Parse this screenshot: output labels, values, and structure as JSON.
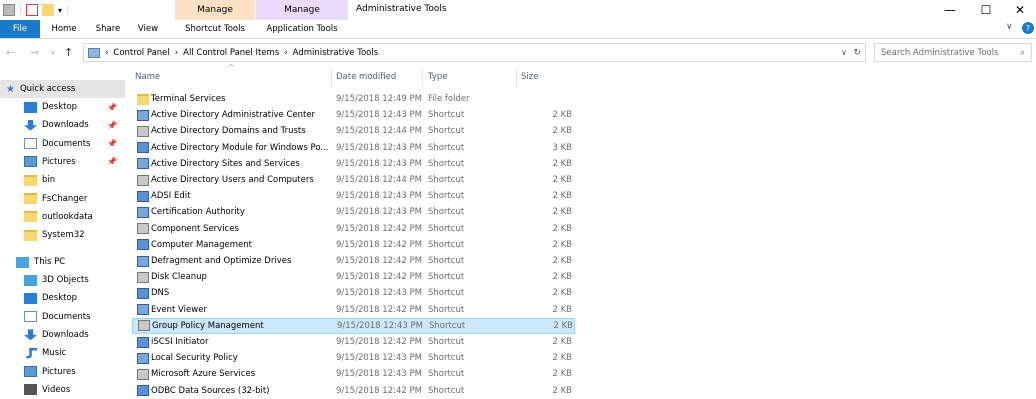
{
  "window": {
    "title": "Administrative Tools",
    "context_groups": [
      {
        "header": "Manage",
        "tab": "Shortcut Tools",
        "color": "#fde1c4"
      },
      {
        "header": "Manage",
        "tab": "Application Tools",
        "color": "#e9dbf9"
      }
    ],
    "controls": {
      "minimize": "—",
      "maximize": "☐",
      "close": "✕"
    }
  },
  "ribbon": {
    "tabs": [
      "File",
      "Home",
      "Share",
      "View"
    ],
    "file_color": "#1979ca"
  },
  "address": {
    "crumbs": [
      "Control Panel",
      "All Control Panel Items",
      "Administrative Tools"
    ],
    "separator": "›",
    "search_placeholder": "Search Administrative Tools"
  },
  "nav": {
    "quick_access": "Quick access",
    "quick_items": [
      {
        "label": "Desktop",
        "icon": "desktop-icon",
        "pinned": true
      },
      {
        "label": "Downloads",
        "icon": "download-icon",
        "pinned": true
      },
      {
        "label": "Documents",
        "icon": "documents-icon",
        "pinned": true
      },
      {
        "label": "Pictures",
        "icon": "pictures-icon",
        "pinned": true
      },
      {
        "label": "bin",
        "icon": "folder-icon",
        "pinned": false
      },
      {
        "label": "FsChanger",
        "icon": "folder-icon",
        "pinned": false
      },
      {
        "label": "outlookdata",
        "icon": "folder-icon",
        "pinned": false
      },
      {
        "label": "System32",
        "icon": "folder-icon",
        "pinned": false
      }
    ],
    "this_pc": "This PC",
    "pc_items": [
      {
        "label": "3D Objects",
        "icon": "3d-objects-icon"
      },
      {
        "label": "Desktop",
        "icon": "desktop-icon"
      },
      {
        "label": "Documents",
        "icon": "documents-icon"
      },
      {
        "label": "Downloads",
        "icon": "download-icon"
      },
      {
        "label": "Music",
        "icon": "music-icon"
      },
      {
        "label": "Pictures",
        "icon": "pictures-icon"
      },
      {
        "label": "Videos",
        "icon": "videos-icon"
      }
    ]
  },
  "columns": {
    "name": "Name",
    "date": "Date modified",
    "type": "Type",
    "size": "Size"
  },
  "files": [
    {
      "name": "Terminal Services",
      "date": "9/15/2018 12:49 PM",
      "type": "File folder",
      "size": "",
      "icon": "folder-icon"
    },
    {
      "name": "Active Directory Administrative Center",
      "date": "9/15/2018 12:43 PM",
      "type": "Shortcut",
      "size": "2 KB",
      "icon": "ad-admin-center-icon"
    },
    {
      "name": "Active Directory Domains and Trusts",
      "date": "9/15/2018 12:44 PM",
      "type": "Shortcut",
      "size": "2 KB",
      "icon": "ad-domains-icon"
    },
    {
      "name": "Active Directory Module for Windows Po...",
      "date": "9/15/2018 12:43 PM",
      "type": "Shortcut",
      "size": "3 KB",
      "icon": "powershell-icon"
    },
    {
      "name": "Active Directory Sites and Services",
      "date": "9/15/2018 12:43 PM",
      "type": "Shortcut",
      "size": "2 KB",
      "icon": "ad-sites-icon"
    },
    {
      "name": "Active Directory Users and Computers",
      "date": "9/15/2018 12:44 PM",
      "type": "Shortcut",
      "size": "2 KB",
      "icon": "ad-users-icon"
    },
    {
      "name": "ADSI Edit",
      "date": "9/15/2018 12:43 PM",
      "type": "Shortcut",
      "size": "2 KB",
      "icon": "adsi-icon"
    },
    {
      "name": "Certification Authority",
      "date": "9/15/2018 12:43 PM",
      "type": "Shortcut",
      "size": "2 KB",
      "icon": "certificate-icon"
    },
    {
      "name": "Component Services",
      "date": "9/15/2018 12:42 PM",
      "type": "Shortcut",
      "size": "2 KB",
      "icon": "component-services-icon"
    },
    {
      "name": "Computer Management",
      "date": "9/15/2018 12:42 PM",
      "type": "Shortcut",
      "size": "2 KB",
      "icon": "computer-management-icon"
    },
    {
      "name": "Defragment and Optimize Drives",
      "date": "9/15/2018 12:42 PM",
      "type": "Shortcut",
      "size": "2 KB",
      "icon": "defrag-icon"
    },
    {
      "name": "Disk Cleanup",
      "date": "9/15/2018 12:42 PM",
      "type": "Shortcut",
      "size": "2 KB",
      "icon": "disk-cleanup-icon"
    },
    {
      "name": "DNS",
      "date": "9/15/2018 12:43 PM",
      "type": "Shortcut",
      "size": "2 KB",
      "icon": "dns-icon"
    },
    {
      "name": "Event Viewer",
      "date": "9/15/2018 12:42 PM",
      "type": "Shortcut",
      "size": "2 KB",
      "icon": "event-viewer-icon"
    },
    {
      "name": "Group Policy Management",
      "date": "9/15/2018 12:43 PM",
      "type": "Shortcut",
      "size": "2 KB",
      "icon": "group-policy-icon",
      "selected": true
    },
    {
      "name": "iSCSI Initiator",
      "date": "9/15/2018 12:42 PM",
      "type": "Shortcut",
      "size": "2 KB",
      "icon": "iscsi-icon"
    },
    {
      "name": "Local Security Policy",
      "date": "9/15/2018 12:43 PM",
      "type": "Shortcut",
      "size": "2 KB",
      "icon": "security-policy-icon"
    },
    {
      "name": "Microsoft Azure Services",
      "date": "9/15/2018 12:43 PM",
      "type": "Shortcut",
      "size": "2 KB",
      "icon": "azure-icon"
    },
    {
      "name": "ODBC Data Sources (32-bit)",
      "date": "9/15/2018 12:42 PM",
      "type": "Shortcut",
      "size": "2 KB",
      "icon": "odbc-icon"
    }
  ]
}
